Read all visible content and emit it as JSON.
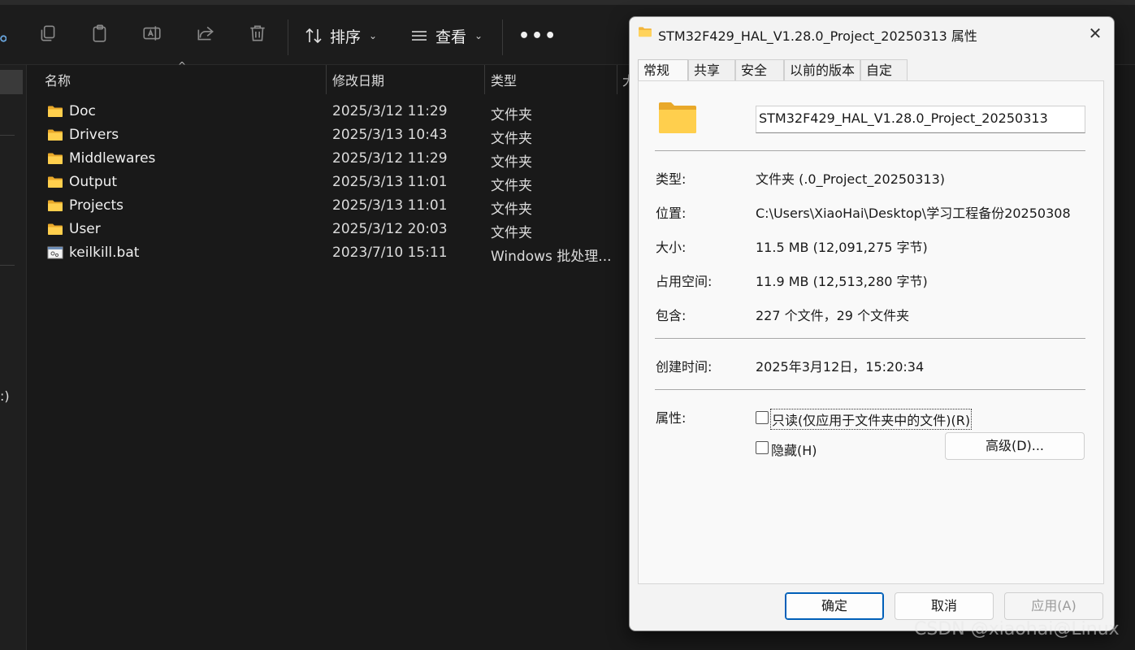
{
  "toolbar": {
    "sort_label": "排序",
    "view_label": "查看",
    "more_label": "•••"
  },
  "columns": {
    "name": "名称",
    "modified": "修改日期",
    "type": "类型",
    "size_fragment": "大"
  },
  "navpane": {
    "fragment": ":)"
  },
  "files": [
    {
      "name": "Doc",
      "modified": "2025/3/12 11:29",
      "type": "文件夹",
      "icon": "folder-icon"
    },
    {
      "name": "Drivers",
      "modified": "2025/3/13 10:43",
      "type": "文件夹",
      "icon": "folder-icon"
    },
    {
      "name": "Middlewares",
      "modified": "2025/3/12 11:29",
      "type": "文件夹",
      "icon": "folder-icon"
    },
    {
      "name": "Output",
      "modified": "2025/3/13 11:01",
      "type": "文件夹",
      "icon": "folder-icon"
    },
    {
      "name": "Projects",
      "modified": "2025/3/13 11:01",
      "type": "文件夹",
      "icon": "folder-icon"
    },
    {
      "name": "User",
      "modified": "2025/3/12 20:03",
      "type": "文件夹",
      "icon": "folder-icon"
    },
    {
      "name": "keilkill.bat",
      "modified": "2023/7/10 15:11",
      "type": "Windows 批处理...",
      "icon": "batch-file-icon"
    }
  ],
  "dialog": {
    "title": "STM32F429_HAL_V1.28.0_Project_20250313 属性",
    "tabs": [
      "常规",
      "共享",
      "安全",
      "以前的版本",
      "自定义"
    ],
    "active_tab": "常规",
    "folder_name": "STM32F429_HAL_V1.28.0_Project_20250313",
    "type_label": "类型:",
    "type_value": "文件夹 (.0_Project_20250313)",
    "location_label": "位置:",
    "location_value": "C:\\Users\\XiaoHai\\Desktop\\学习工程备份20250308",
    "size_label": "大小:",
    "size_value": "11.5 MB (12,091,275 字节)",
    "size_on_disk_label": "占用空间:",
    "size_on_disk_value": "11.9 MB (12,513,280 字节)",
    "contains_label": "包含:",
    "contains_value": "227 个文件，29 个文件夹",
    "created_label": "创建时间:",
    "created_value": "2025年3月12日，15:20:34",
    "attributes_label": "属性:",
    "readonly_label": "只读(仅应用于文件夹中的文件)(R)",
    "hidden_label": "隐藏(H)",
    "advanced_label": "高级(D)...",
    "ok_label": "确定",
    "cancel_label": "取消",
    "apply_label": "应用(A)"
  },
  "watermark": "CSDN @xiaohai@Linux"
}
